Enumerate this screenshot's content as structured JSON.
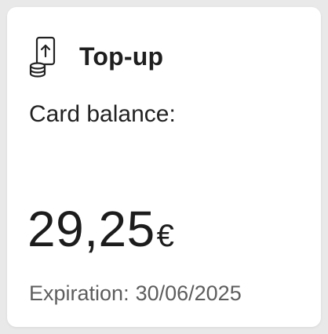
{
  "card": {
    "title": "Top-up",
    "icon": "phone-topup-coins-icon",
    "balance_label": "Card balance:",
    "balance_value": "29,25",
    "currency": "€",
    "expiration_label": "Expiration:",
    "expiration_date": "30/06/2025"
  },
  "colors": {
    "card_background": "#ffffff",
    "page_background": "#e9e9e9",
    "text_primary": "#1f1f1f",
    "text_secondary": "#5d5d5d"
  }
}
